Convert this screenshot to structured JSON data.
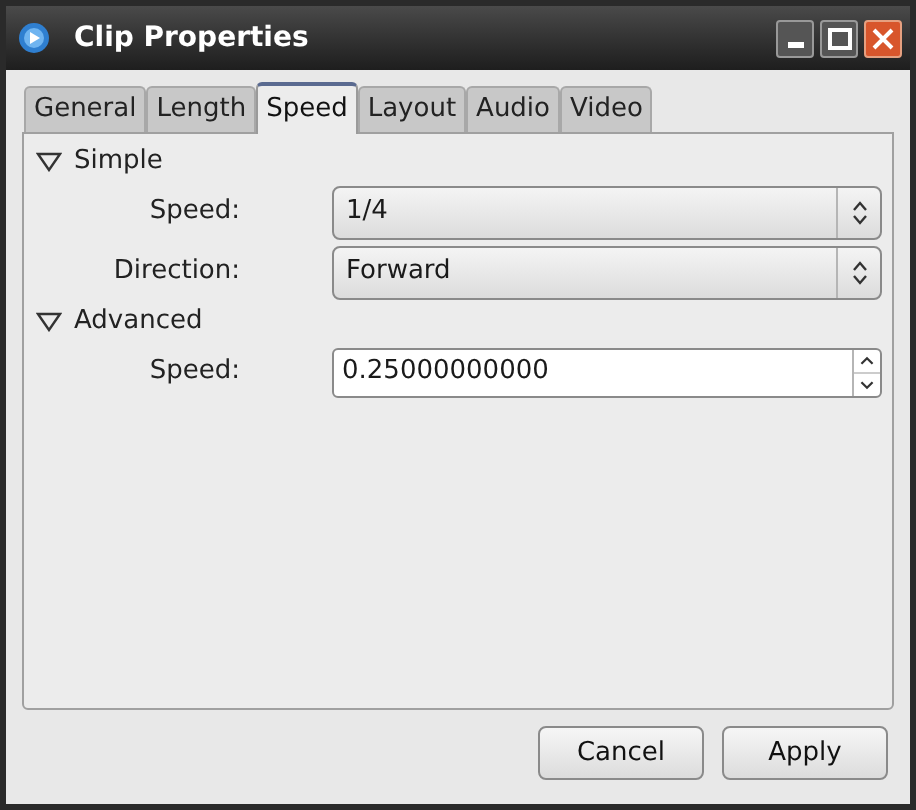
{
  "window": {
    "title": "Clip Properties"
  },
  "tabs": [
    {
      "label": "General",
      "selected": false
    },
    {
      "label": "Length",
      "selected": false
    },
    {
      "label": "Speed",
      "selected": true
    },
    {
      "label": "Layout",
      "selected": false
    },
    {
      "label": "Audio",
      "selected": false
    },
    {
      "label": "Video",
      "selected": false
    }
  ],
  "sections": [
    {
      "title": "Simple",
      "expanded": true,
      "fields": [
        {
          "label": "Speed:",
          "kind": "select",
          "value": "1/4"
        },
        {
          "label": "Direction:",
          "kind": "select",
          "value": "Forward"
        }
      ]
    },
    {
      "title": "Advanced",
      "expanded": true,
      "fields": [
        {
          "label": "Speed:",
          "kind": "spin",
          "value": "0.25000000000"
        }
      ]
    }
  ],
  "buttons": [
    "Cancel",
    "Apply"
  ]
}
